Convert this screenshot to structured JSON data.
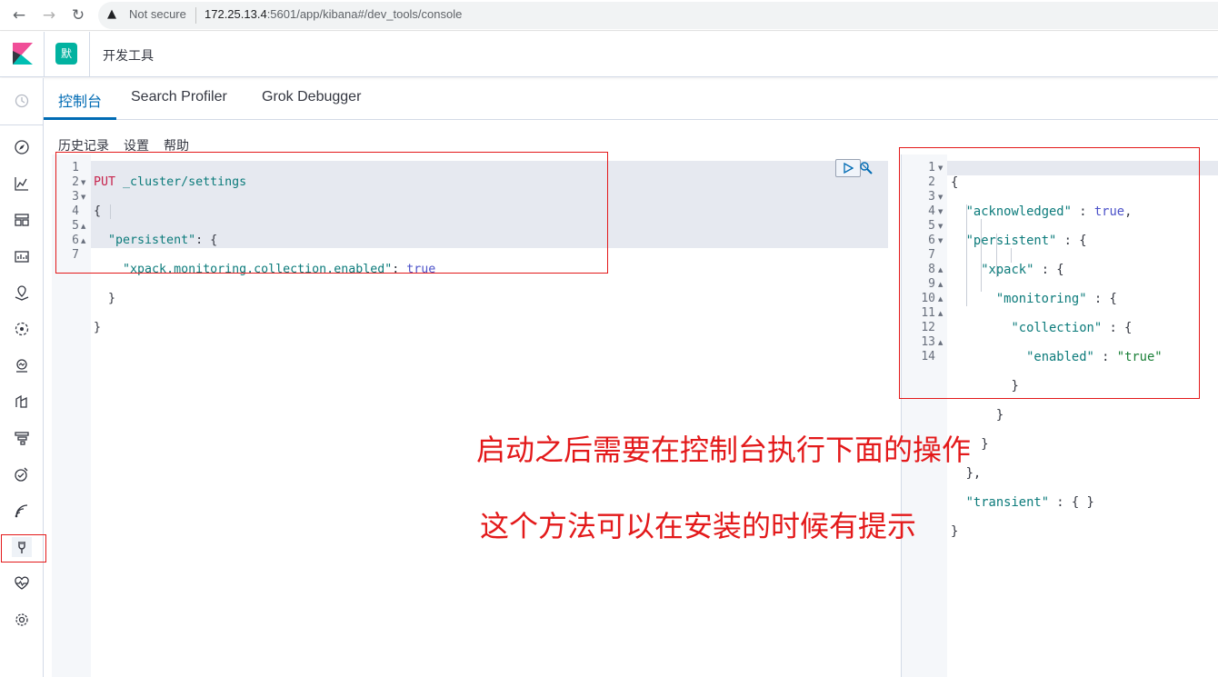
{
  "browser": {
    "warning_icon": "warning-icon",
    "not_secure": "Not secure",
    "url_host": "172.25.13.4",
    "url_rest": ":5601/app/kibana#/dev_tools/console"
  },
  "header": {
    "space_initial": "默",
    "breadcrumb": "开发工具"
  },
  "tabs": [
    {
      "label": "控制台",
      "active": true
    },
    {
      "label": "Search Profiler",
      "active": false
    },
    {
      "label": "Grok Debugger",
      "active": false
    }
  ],
  "console_menu": {
    "history": "历史记录",
    "settings": "设置",
    "help": "帮助"
  },
  "request": {
    "line_numbers": [
      "1",
      "2",
      "3",
      "4",
      "5",
      "6",
      "7"
    ],
    "method": "PUT",
    "path": "_cluster/settings",
    "key_persistent": "\"persistent\"",
    "key_setting": "\"xpack.monitoring.collection.enabled\"",
    "value": "true"
  },
  "response": {
    "line_numbers": [
      "1",
      "2",
      "3",
      "4",
      "5",
      "6",
      "7",
      "8",
      "9",
      "10",
      "11",
      "12",
      "13",
      "14"
    ],
    "key_acknowledged": "\"acknowledged\"",
    "val_acknowledged": "true",
    "key_persistent": "\"persistent\"",
    "key_xpack": "\"xpack\"",
    "key_monitoring": "\"monitoring\"",
    "key_collection": "\"collection\"",
    "key_enabled": "\"enabled\"",
    "val_enabled": "\"true\"",
    "key_transient": "\"transient\"",
    "val_transient": "{ }"
  },
  "annotations": {
    "line1": "启动之后需要在控制台执行下面的操作",
    "line2": "这个方法可以在安装的时候有提示",
    "color": "#e3191a"
  },
  "colors": {
    "accent": "#006bb4",
    "space_avatar": "#01b2a0"
  }
}
